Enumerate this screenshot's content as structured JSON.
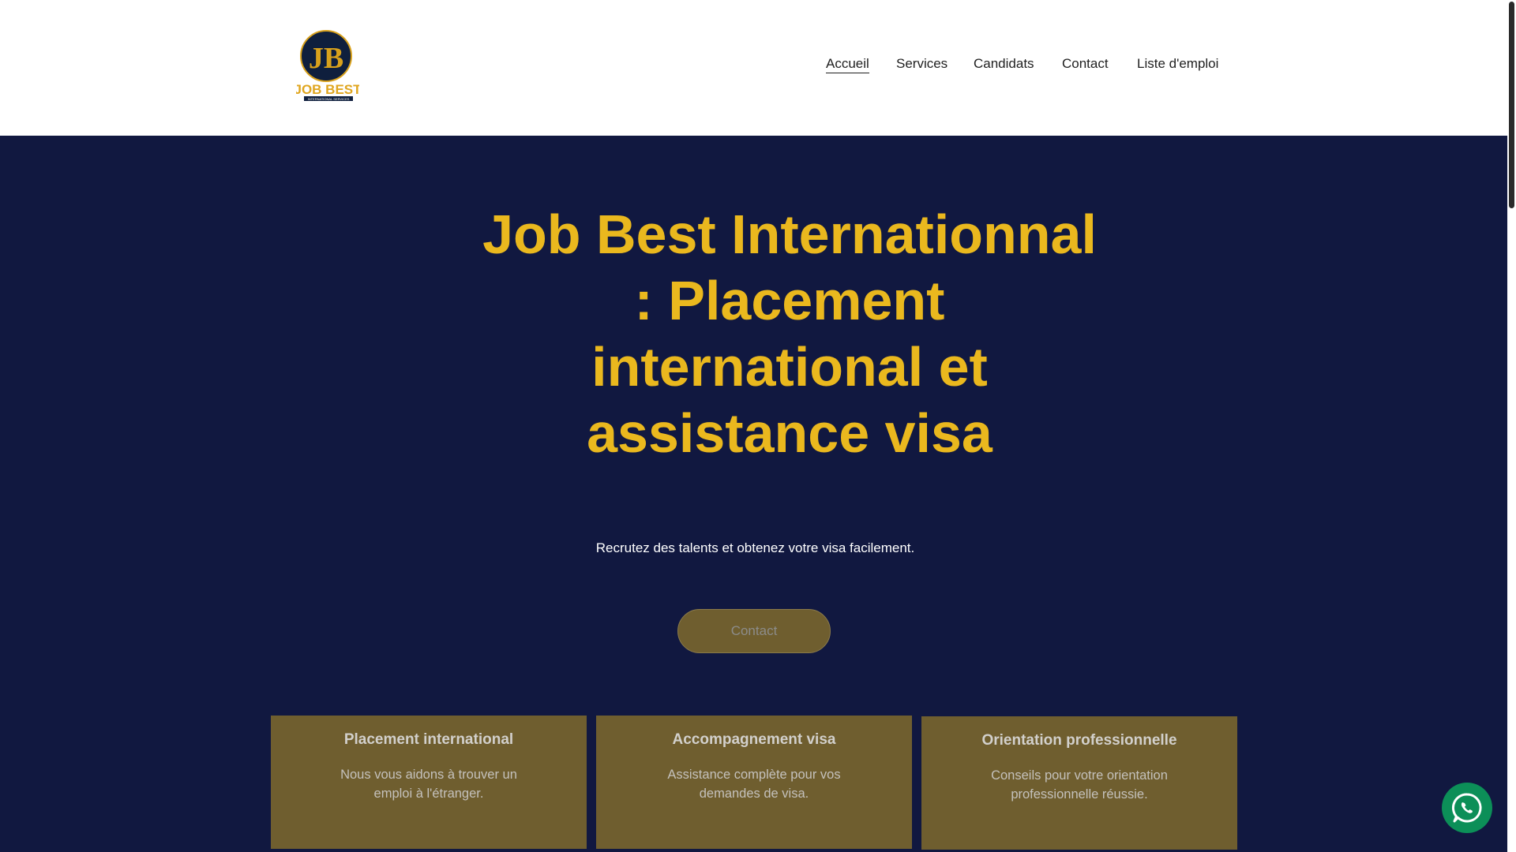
{
  "logo": {
    "alt": "Job Best International Services logo",
    "wordmark": "JOB BEST",
    "tagline": "INTERNATIONAL SERVICES",
    "monogram": "JB"
  },
  "nav": {
    "items": [
      {
        "label": "Accueil",
        "active": true
      },
      {
        "label": "Services",
        "active": false
      },
      {
        "label": "Candidats",
        "active": false
      },
      {
        "label": "Contact",
        "active": false
      },
      {
        "label": "Liste d'emploi",
        "active": false
      }
    ]
  },
  "hero": {
    "title_lines": [
      "Job Best Internationnal",
      ": Placement",
      "international et",
      "assistance visa"
    ],
    "subtitle": "Recrutez des talents et obtenez votre visa facilement.",
    "cta_label": "Contact"
  },
  "cards": [
    {
      "title": "Placement international",
      "text": "Nous vous aidons à trouver un emploi à l'étranger."
    },
    {
      "title": "Accompagnement visa",
      "text": "Assistance complète pour vos demandes de visa."
    },
    {
      "title": "Orientation professionnelle",
      "text": "Conseils pour votre orientation professionnelle réussie."
    }
  ],
  "colors": {
    "hero_bg": "#111840",
    "accent_gold": "#eab81e",
    "card_bg": "#6f5e2f",
    "whatsapp_green": "#0c8f58"
  },
  "icons": {
    "whatsapp": "whatsapp-icon"
  }
}
